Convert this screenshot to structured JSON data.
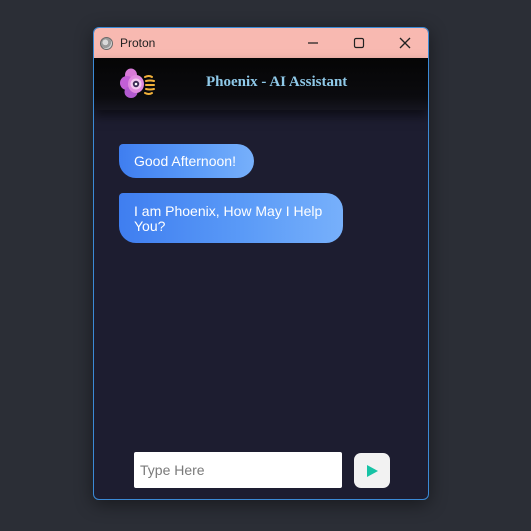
{
  "window": {
    "title": "Proton",
    "icon": "proton-app-icon",
    "controls": [
      "minimize-icon",
      "maximize-icon",
      "close-icon"
    ],
    "titlebar_color": "#f8b9b1",
    "border_color": "#3b8ad6"
  },
  "header": {
    "title": "Phoenix - AI Assistant",
    "logo": "phoenix-logo-icon",
    "title_color": "#8fc9e8"
  },
  "chat": {
    "messages": [
      {
        "text": "Good Afternoon!"
      },
      {
        "text": "I am Phoenix, How May I Help You?"
      }
    ],
    "bubble_color": "#4a8df5",
    "background": "#1d1d30"
  },
  "composer": {
    "placeholder": "Type Here",
    "value": "",
    "send_icon": "send-play-icon",
    "send_icon_color": "#17c3a5"
  }
}
